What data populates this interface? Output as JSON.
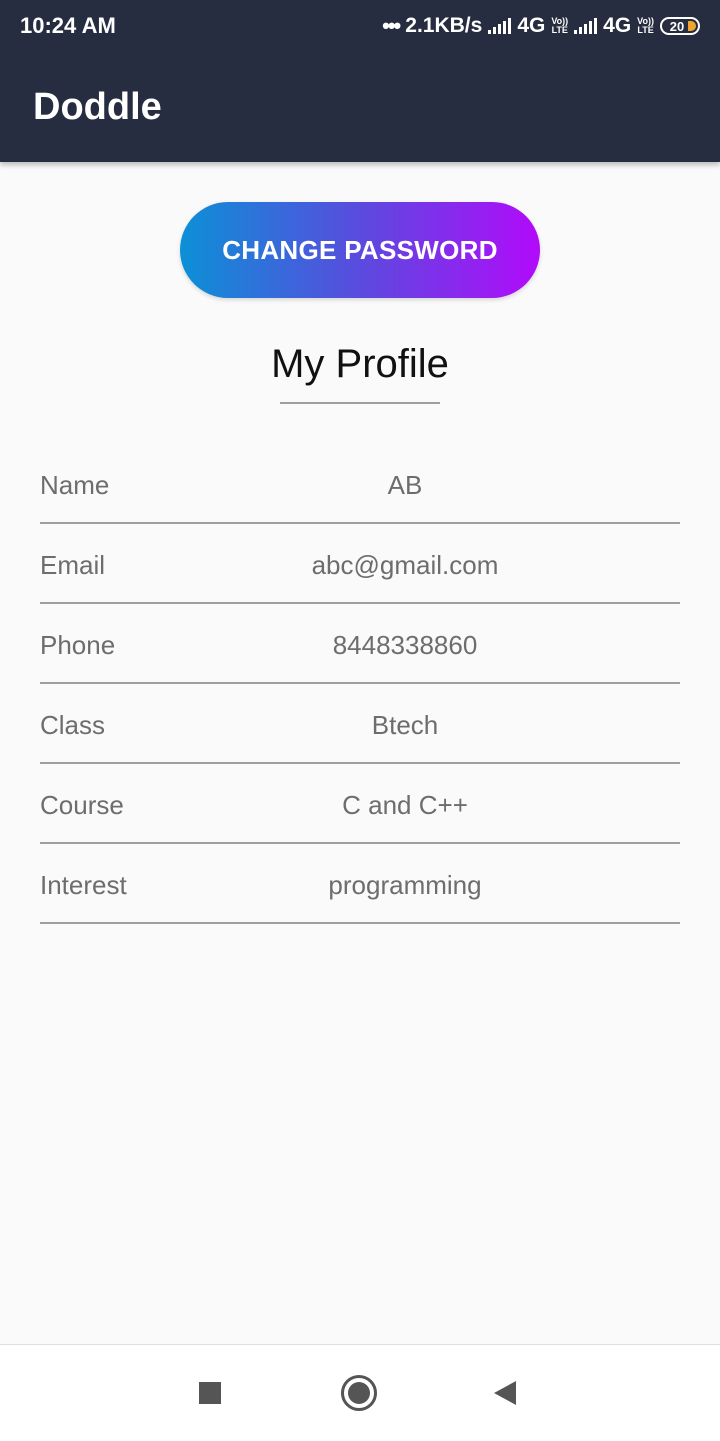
{
  "status_bar": {
    "time": "10:24 AM",
    "dots": "•••",
    "speed": "2.1KB/s",
    "network_1": "4G",
    "network_2": "4G",
    "volte_top": "Vo))",
    "volte_bottom": "LTE",
    "battery": "20",
    "battery_color": "#f2a52c"
  },
  "app_bar": {
    "title": "Doddle",
    "background": "#272d40"
  },
  "change_password_button": {
    "label": "CHANGE PASSWORD",
    "gradient": [
      "#0c90d6",
      "#5a4bde",
      "#b20afb"
    ]
  },
  "profile": {
    "title": "My Profile",
    "fields": [
      {
        "label": "Name",
        "value": "AB"
      },
      {
        "label": "Email",
        "value": "abc@gmail.com"
      },
      {
        "label": "Phone",
        "value": "8448338860"
      },
      {
        "label": "Class",
        "value": "Btech"
      },
      {
        "label": "Course",
        "value": "C and C++"
      },
      {
        "label": "Interest",
        "value": "programming"
      }
    ]
  },
  "nav_bar": {
    "icons": [
      "recents-square-icon",
      "home-circle-icon",
      "back-triangle-icon"
    ]
  }
}
